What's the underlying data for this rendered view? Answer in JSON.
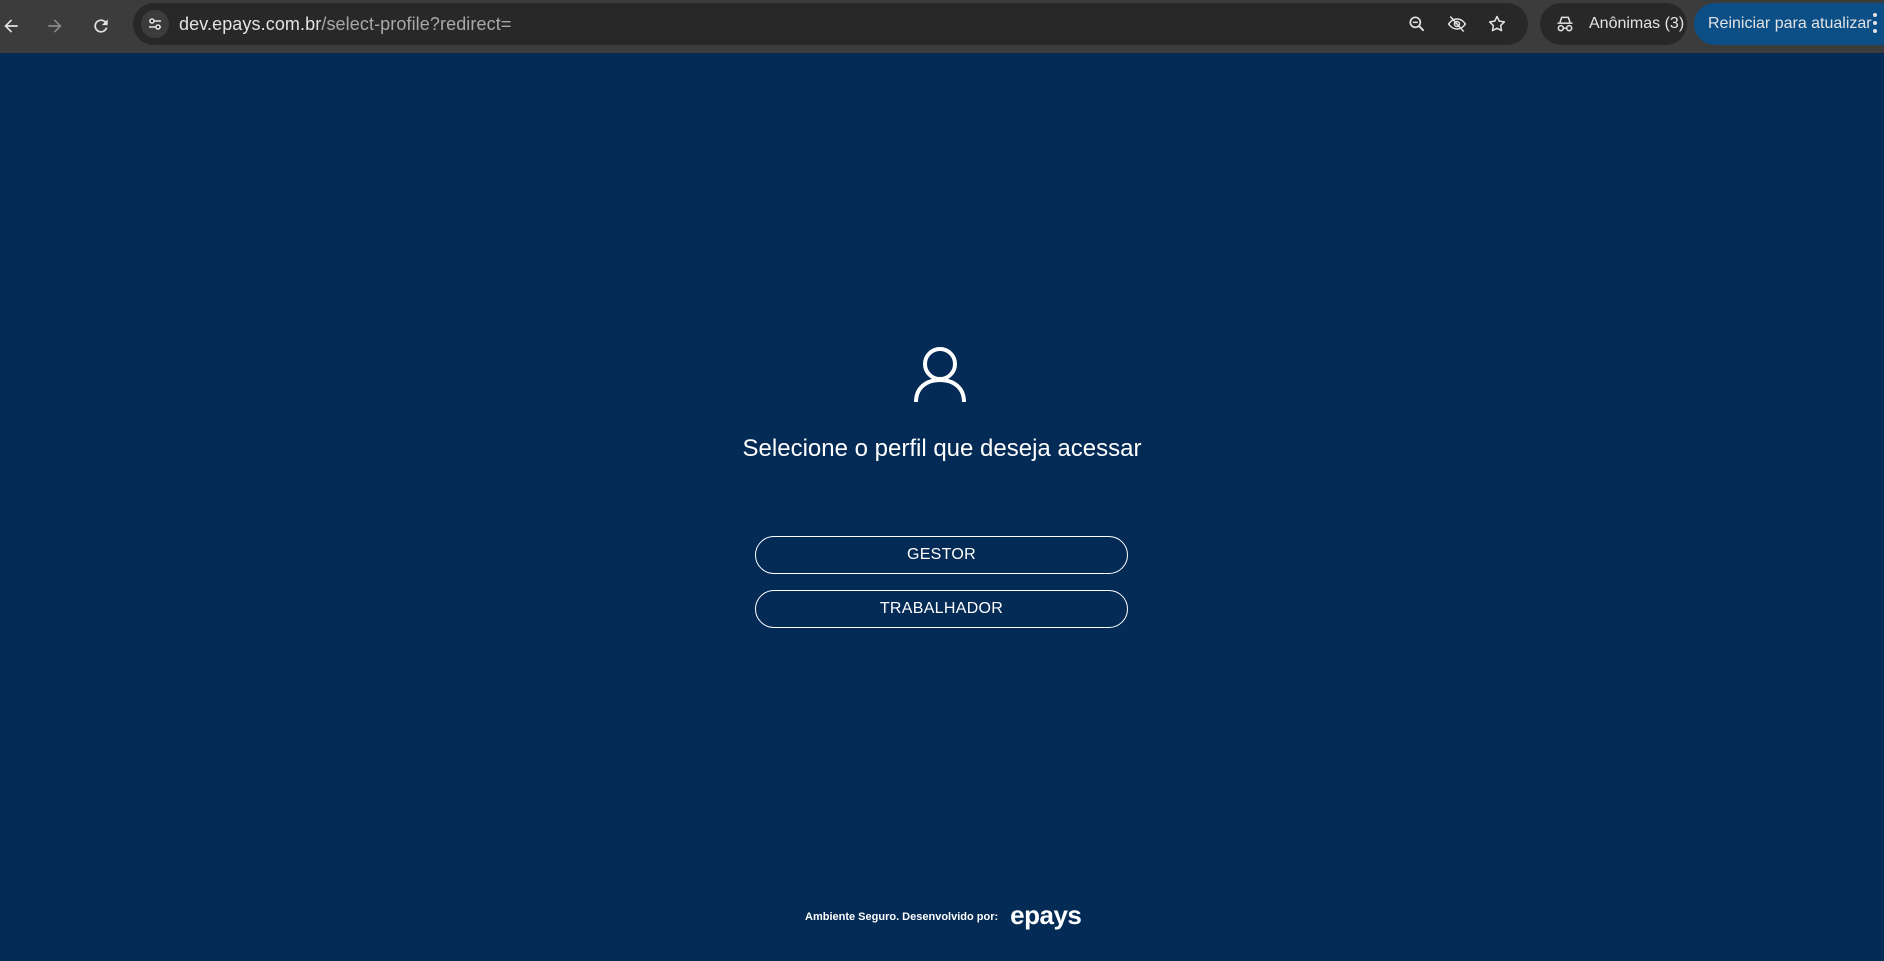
{
  "browser": {
    "url_host": "dev.epays.com.br",
    "url_path": "/select-profile?redirect=",
    "incognito_label": "Anônimas (3)",
    "update_label": "Reiniciar para atualizar",
    "icons": [
      "back-icon",
      "forward-icon",
      "reload-icon",
      "site-info-icon",
      "zoom-icon",
      "eye-off-icon",
      "star-icon",
      "incognito-icon",
      "menu-icon"
    ]
  },
  "page": {
    "icon": "user-icon",
    "title": "Selecione o perfil que deseja acessar",
    "profiles": [
      "GESTOR",
      "TRABALHADOR"
    ],
    "footer_text": "Ambiente Seguro. Desenvolvido por:",
    "footer_logo": "epays"
  },
  "colors": {
    "background": "#032b55",
    "toolbar": "#3c3c3c",
    "omnibox": "#282828",
    "update_button": "#0b4f86",
    "text": "#ffffff"
  }
}
